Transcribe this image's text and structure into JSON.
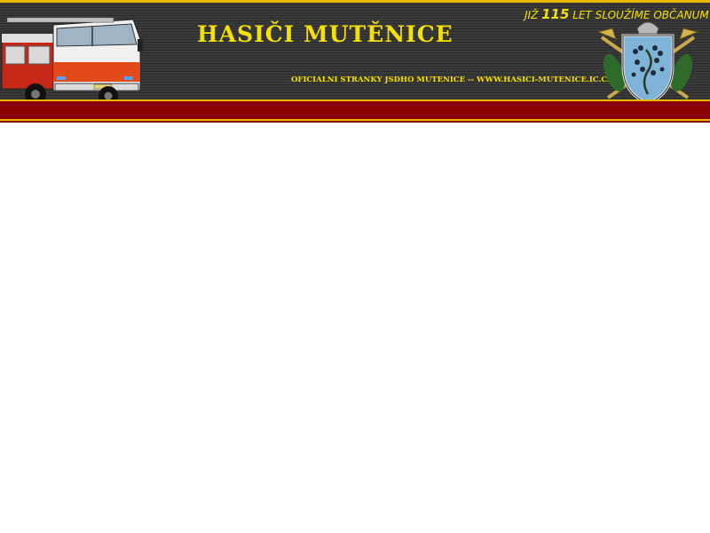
{
  "header": {
    "title": "HASIČI MUTĚNICE",
    "subtitle": "OFICIALNI STRANKY JSDHO MUTENICE  --  WWW.HASICI-MUTENICE.IC.CZ",
    "slogan_prefix": "JIŽ ",
    "slogan_number": "115",
    "slogan_suffix": " LET SLOUŽÍME  OBČANUM"
  },
  "images": {
    "truck": "fire-truck",
    "emblem": "fire-brigade-emblem"
  },
  "colors": {
    "banner_background": "#333333",
    "title_yellow": "#f5e100",
    "band_red": "#8a0000",
    "stripe_gold": "#e8b700",
    "page_background": "#ffffff"
  }
}
